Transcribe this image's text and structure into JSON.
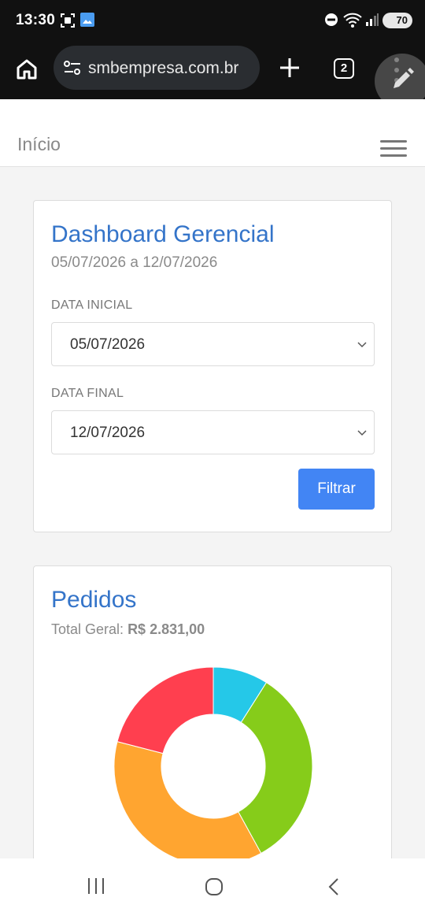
{
  "status_bar": {
    "time": "13:30",
    "battery": "70",
    "icons": [
      "screenshot-icon",
      "gallery-icon",
      "do-not-disturb-icon",
      "wifi-icon",
      "signal-icon",
      "battery-icon"
    ]
  },
  "browser": {
    "url": "smbempresa.com.br",
    "tab_count": "2",
    "icons": [
      "home-icon",
      "site-settings-icon",
      "new-tab-icon",
      "tab-switcher-icon",
      "more-menu-icon",
      "edit-icon"
    ]
  },
  "navbar": {
    "brand": "Início",
    "menu_icon": "hamburger-icon"
  },
  "dashboard": {
    "title": "Dashboard Gerencial",
    "date_range": "05/07/2026 a 12/07/2026",
    "start_label": "DATA INICIAL",
    "start_value": "05/07/2026",
    "end_label": "DATA FINAL",
    "end_value": "12/07/2026",
    "filter_button": "Filtrar"
  },
  "orders": {
    "title": "Pedidos",
    "total_label": "Total Geral:",
    "total_value": "R$ 2.831,00",
    "chart_data": {
      "type": "pie",
      "categories": [
        "",
        "",
        "",
        ""
      ],
      "values": [
        9,
        33,
        37,
        21
      ],
      "colors": [
        "#25c8e8",
        "#86cc1a",
        "#ffa530",
        "#ff3f4f"
      ],
      "title": "",
      "donut": true
    }
  },
  "system_nav": {
    "icons": [
      "recent-apps-icon",
      "home-circle-icon",
      "back-icon"
    ]
  }
}
